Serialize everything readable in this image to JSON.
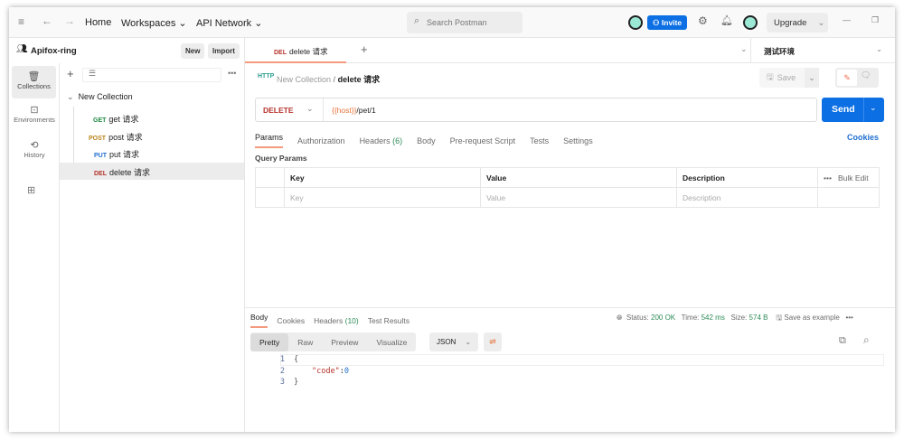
{
  "topbar": {
    "home": "Home",
    "workspaces": "Workspaces",
    "api_network": "API Network",
    "search_placeholder": "Search Postman",
    "invite": "Invite",
    "upgrade": "Upgrade"
  },
  "sidebar": {
    "workspace": "Apifox-ring",
    "new": "New",
    "import": "Import",
    "rail": [
      {
        "label": "Collections"
      },
      {
        "label": "Environments"
      },
      {
        "label": "History"
      }
    ],
    "collection": "New Collection",
    "requests": [
      {
        "method": "GET",
        "name": "get 请求",
        "color": "#1e8a43"
      },
      {
        "method": "POST",
        "name": "post 请求",
        "color": "#b9851a"
      },
      {
        "method": "PUT",
        "name": "put 请求",
        "color": "#1f6fd1"
      },
      {
        "method": "DEL",
        "name": "delete 请求",
        "color": "#b5332b"
      }
    ]
  },
  "tab": {
    "method": "DEL",
    "name": "delete 请求"
  },
  "env": "测试环境",
  "breadcrumb": {
    "collection": "New Collection",
    "sep": "/",
    "request": "delete 请求"
  },
  "save": "Save",
  "request": {
    "method": "DELETE",
    "url_var": "{{host}}",
    "url_path": "/pet/1",
    "send": "Send"
  },
  "req_tabs": [
    {
      "label": "Params"
    },
    {
      "label": "Authorization"
    },
    {
      "label": "Headers",
      "count": "(6)"
    },
    {
      "label": "Body"
    },
    {
      "label": "Pre-request Script"
    },
    {
      "label": "Tests"
    },
    {
      "label": "Settings"
    }
  ],
  "cookies": "Cookies",
  "query_params": {
    "title": "Query Params",
    "headers": [
      "Key",
      "Value",
      "Description"
    ],
    "bulk_edit": "Bulk Edit",
    "placeholders": [
      "Key",
      "Value",
      "Description"
    ]
  },
  "response": {
    "tabs": [
      {
        "label": "Body"
      },
      {
        "label": "Cookies"
      },
      {
        "label": "Headers",
        "count": "(10)"
      },
      {
        "label": "Test Results"
      }
    ],
    "status_label": "Status:",
    "status": "200 OK",
    "time_label": "Time:",
    "time": "542 ms",
    "size_label": "Size:",
    "size": "574 B",
    "save_example": "Save as example",
    "views": [
      "Pretty",
      "Raw",
      "Preview",
      "Visualize"
    ],
    "format": "JSON",
    "lines": [
      {
        "n": "1",
        "text": "{"
      },
      {
        "n": "2",
        "key": "\"code\"",
        "value": "0"
      },
      {
        "n": "3",
        "text": "}"
      }
    ]
  }
}
